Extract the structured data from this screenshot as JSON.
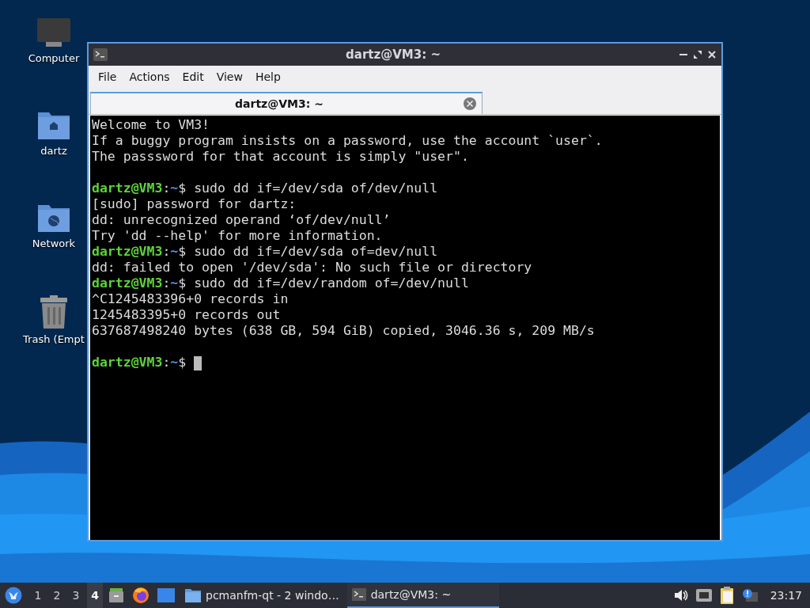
{
  "desktop_icons": [
    {
      "label": "Computer",
      "kind": "computer"
    },
    {
      "label": "dartz",
      "kind": "home"
    },
    {
      "label": "Network",
      "kind": "network"
    },
    {
      "label": "Trash (Empt",
      "kind": "trash"
    }
  ],
  "window": {
    "title": "dartz@VM3: ~",
    "menu": [
      "File",
      "Actions",
      "Edit",
      "View",
      "Help"
    ],
    "tabs": [
      {
        "label": "dartz@VM3: ~",
        "selected": true
      }
    ],
    "terminal": {
      "lines": [
        {
          "kind": "output",
          "text": "Welcome to VM3!"
        },
        {
          "kind": "output",
          "text": "If a buggy program insists on a password, use the account `user`."
        },
        {
          "kind": "output",
          "text": "The passsword for that account is simply \"user\"."
        },
        {
          "kind": "blank"
        },
        {
          "kind": "prompt",
          "user": "dartz@VM3",
          "separator": ":",
          "path": "~",
          "symbol": "$",
          "command": "sudo dd if=/dev/sda of/dev/null",
          "cursor": false
        },
        {
          "kind": "output",
          "text": "[sudo] password for dartz:"
        },
        {
          "kind": "output",
          "text": "dd: unrecognized operand ‘of/dev/null’"
        },
        {
          "kind": "output",
          "text": "Try 'dd --help' for more information."
        },
        {
          "kind": "prompt",
          "user": "dartz@VM3",
          "separator": ":",
          "path": "~",
          "symbol": "$",
          "command": "sudo dd if=/dev/sda of=dev/null",
          "cursor": false
        },
        {
          "kind": "output",
          "text": "dd: failed to open '/dev/sda': No such file or directory"
        },
        {
          "kind": "prompt",
          "user": "dartz@VM3",
          "separator": ":",
          "path": "~",
          "symbol": "$",
          "command": "sudo dd if=/dev/random of=/dev/null",
          "cursor": false
        },
        {
          "kind": "output",
          "text": "^C1245483396+0 records in"
        },
        {
          "kind": "output",
          "text": "1245483395+0 records out"
        },
        {
          "kind": "output",
          "text": "637687498240 bytes (638 GB, 594 GiB) copied, 3046.36 s, 209 MB/s"
        },
        {
          "kind": "blank"
        },
        {
          "kind": "prompt",
          "user": "dartz@VM3",
          "separator": ":",
          "path": "~",
          "symbol": "$",
          "cursor": true
        }
      ]
    }
  },
  "taskbar": {
    "workspaces": [
      {
        "label": "1",
        "selected": false
      },
      {
        "label": "2",
        "selected": false
      },
      {
        "label": "3",
        "selected": false
      },
      {
        "label": "4",
        "selected": true
      }
    ],
    "launchers": [
      {
        "kind": "files"
      },
      {
        "kind": "browser"
      },
      {
        "kind": "desktop"
      }
    ],
    "tasks": [
      {
        "label": "pcmanfm-qt - 2 windo…",
        "kind": "folder",
        "selected": false
      },
      {
        "label": "dartz@VM3: ~",
        "kind": "terminal",
        "selected": true
      }
    ],
    "tray": [
      {
        "kind": "volume"
      },
      {
        "kind": "network"
      },
      {
        "kind": "clipboard"
      },
      {
        "kind": "notification"
      }
    ],
    "clock": "23:17"
  }
}
